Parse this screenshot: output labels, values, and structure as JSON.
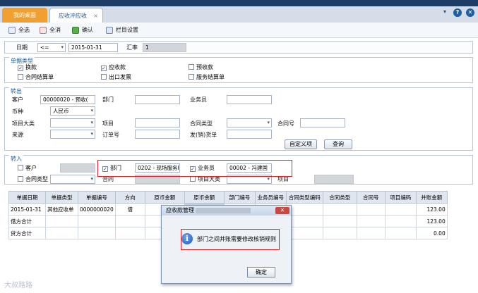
{
  "tabs": {
    "home": "我的桌面",
    "active": "应收冲应收"
  },
  "toolbar": {
    "select_all": "全选",
    "deselect_all": "全消",
    "confirm": "确认",
    "column_settings": "栏目设置"
  },
  "datebar": {
    "date_label": "日期",
    "date_direction": "<=",
    "date_value": "2015-01-31",
    "rate_label": "汇率",
    "rate_value": "1"
  },
  "doc_types": {
    "title": "单据类型",
    "items": [
      {
        "label": "换款",
        "checked": true
      },
      {
        "label": "应收款",
        "checked": true
      },
      {
        "label": "预收款",
        "checked": false
      },
      {
        "label": "合同结算单",
        "checked": false
      },
      {
        "label": "出口发票",
        "checked": false
      },
      {
        "label": "服务结算单",
        "checked": false
      }
    ]
  },
  "transfer_out": {
    "title": "转出",
    "customer_label": "客户",
    "customer_value": "00000020 - 预收(",
    "dept_label": "部门",
    "salesman_label": "业务员",
    "currency_label": "币种",
    "currency_value": "人民币",
    "project_cat_label": "项目大类",
    "project_label": "项目",
    "contract_type_label": "合同类型",
    "contract_no_label": "合同号",
    "source_label": "来源",
    "order_label": "订单号",
    "invoice_label": "发(销)货单",
    "custom_btn": "自定义项",
    "query_btn": "查询"
  },
  "transfer_in": {
    "title": "转入",
    "customer_label": "客户",
    "customer_checked": false,
    "dept_label": "部门",
    "dept_checked": true,
    "dept_value": "0202 - 现场服务I",
    "salesman_label": "业务员",
    "salesman_checked": true,
    "salesman_value": "00002 - 冯建国",
    "contract_type_label": "合同类型",
    "contract_type_checked": false,
    "contract_label": "合同",
    "project_cat_label": "项目大类",
    "project_cat_checked": false,
    "project_label": "项目"
  },
  "grid": {
    "headers": [
      "单据日期",
      "单据类型",
      "单据编号",
      "方向",
      "原币金额",
      "原币余额",
      "部门编号",
      "业务员编号",
      "合同类型编码",
      "合同类型",
      "合同号",
      "项目编码",
      "并账金额"
    ],
    "rows": [
      [
        "2015-01-31",
        "其他应收单",
        "0000000020",
        "借",
        "",
        "",
        "",
        "",
        "",
        "",
        "",
        "",
        "123.00"
      ],
      [
        "借方合计",
        "",
        "",
        "",
        "",
        "",
        "",
        "",
        "",
        "",
        "",
        "",
        "123.00"
      ],
      [
        "贷方合计",
        "",
        "",
        "",
        "",
        "",
        "",
        "",
        "",
        "",
        "",
        "",
        "0.00"
      ]
    ]
  },
  "dialog": {
    "title": "应收款管理",
    "message": "部门之间并账需要修改核销规则",
    "ok_label": "确定",
    "close_label": "✕"
  },
  "watermark": "大叔路路",
  "window_controls": {
    "pin": "▾",
    "help": "?",
    "close": "✕"
  },
  "icons": [
    "select-all-icon",
    "deselect-all-icon",
    "confirm-icon",
    "column-settings-icon",
    "info-icon"
  ]
}
